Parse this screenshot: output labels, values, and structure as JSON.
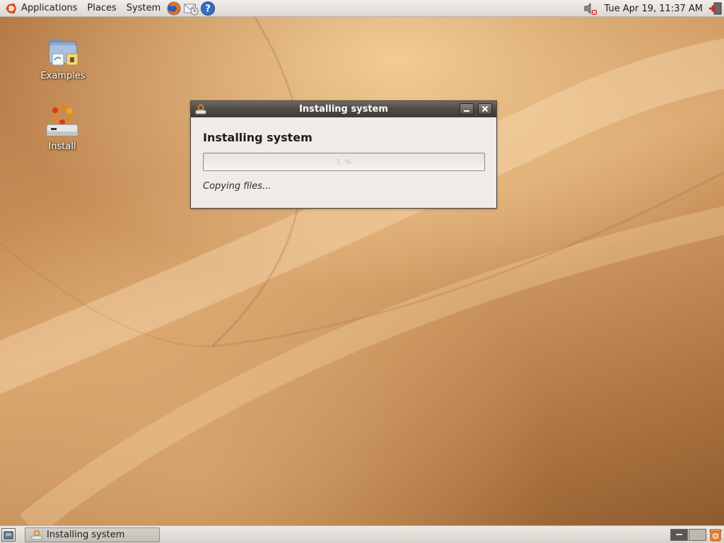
{
  "top_panel": {
    "menus": [
      "Applications",
      "Places",
      "System"
    ],
    "launchers": [
      "firefox-icon",
      "mail-icon",
      "help-icon"
    ],
    "clock": "Tue Apr 19, 11:37 AM",
    "tray_icons": [
      "volume-muted-icon",
      "shutdown-icon"
    ]
  },
  "desktop": {
    "icons": [
      {
        "name": "examples",
        "label": "Examples",
        "icon": "folder-icon"
      },
      {
        "name": "install",
        "label": "Install",
        "icon": "installer-icon"
      }
    ]
  },
  "dialog": {
    "window_title": "Installing system",
    "heading": "Installing system",
    "progress": {
      "fraction": 0.0,
      "text": "1 %"
    },
    "status": "Copying files..."
  },
  "bottom_panel": {
    "task_label": "Installing system"
  },
  "colors": {
    "panel": "#e4e1dc",
    "titlebar": "#4f4b47",
    "dialog_bg": "#efebe7",
    "wallpaper": "#c68d57"
  }
}
